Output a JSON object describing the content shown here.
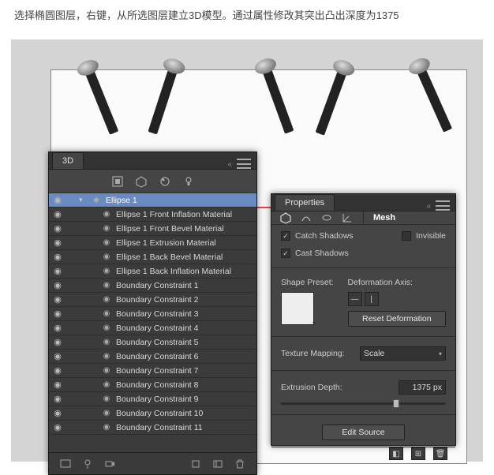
{
  "instruction": "选择椭圆图层，右键，从所选图层建立3D模型。通过属性修改其突出凸出深度为1375",
  "panel3d": {
    "tab": "3D",
    "layers": [
      {
        "name": "Ellipse 1",
        "selected": true,
        "indent": 1,
        "icon": "▾"
      },
      {
        "name": "Ellipse 1 Front Inflation Material",
        "indent": 2,
        "icon": "mat"
      },
      {
        "name": "Ellipse 1 Front Bevel Material",
        "indent": 2,
        "icon": "mat"
      },
      {
        "name": "Ellipse 1 Extrusion Material",
        "indent": 2,
        "icon": "mat"
      },
      {
        "name": "Ellipse 1 Back Bevel Material",
        "indent": 2,
        "icon": "mat"
      },
      {
        "name": "Ellipse 1 Back Inflation Material",
        "indent": 2,
        "icon": "mat"
      },
      {
        "name": "Boundary Constraint 1",
        "indent": 2,
        "icon": "mat"
      },
      {
        "name": "Boundary Constraint 2",
        "indent": 2,
        "icon": "mat"
      },
      {
        "name": "Boundary Constraint 3",
        "indent": 2,
        "icon": "mat"
      },
      {
        "name": "Boundary Constraint 4",
        "indent": 2,
        "icon": "mat"
      },
      {
        "name": "Boundary Constraint 5",
        "indent": 2,
        "icon": "mat"
      },
      {
        "name": "Boundary Constraint 6",
        "indent": 2,
        "icon": "mat"
      },
      {
        "name": "Boundary Constraint 7",
        "indent": 2,
        "icon": "mat"
      },
      {
        "name": "Boundary Constraint 8",
        "indent": 2,
        "icon": "mat"
      },
      {
        "name": "Boundary Constraint 9",
        "indent": 2,
        "icon": "mat"
      },
      {
        "name": "Boundary Constraint 10",
        "indent": 2,
        "icon": "mat"
      },
      {
        "name": "Boundary Constraint 11",
        "indent": 2,
        "icon": "mat"
      }
    ]
  },
  "props": {
    "tab": "Properties",
    "toolLabel": "Mesh",
    "catchShadows": "Catch Shadows",
    "castShadows": "Cast Shadows",
    "invisible": "Invisible",
    "shapePreset": "Shape Preset:",
    "deformationAxis": "Deformation Axis:",
    "resetDeformation": "Reset Deformation",
    "textureMapping": "Texture Mapping:",
    "textureMappingValue": "Scale",
    "extrusionDepth": "Extrusion Depth:",
    "extrusionValue": "1375 px",
    "editSource": "Edit Source"
  }
}
